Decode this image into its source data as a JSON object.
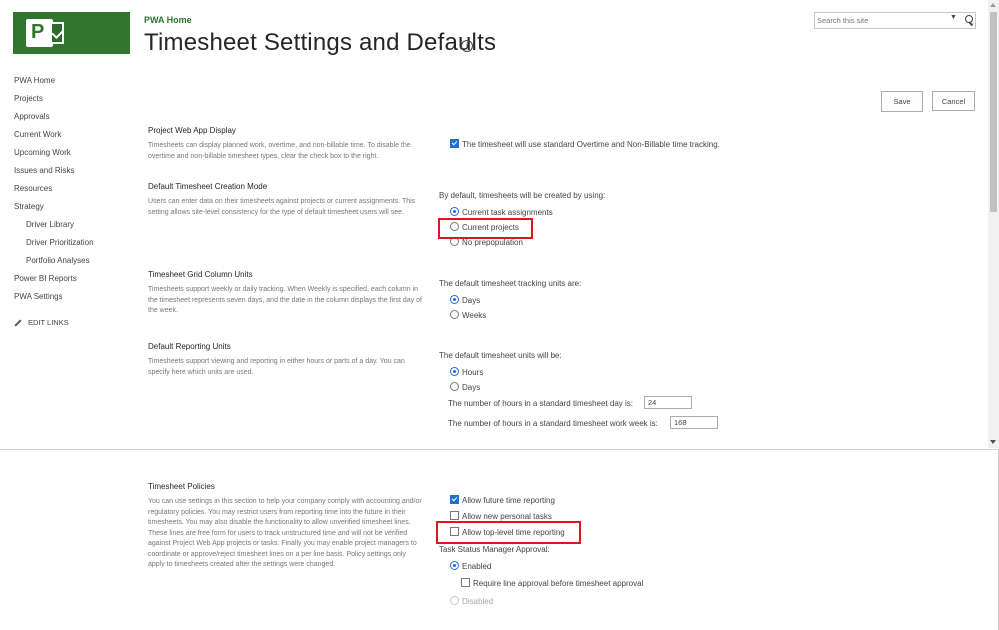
{
  "header": {
    "logo_letter": "P",
    "breadcrumb": "PWA Home",
    "title": "Timesheet Settings and Defaults",
    "info_glyph": "i"
  },
  "search": {
    "placeholder": "Search this site",
    "scope_glyph": "▼"
  },
  "nav": {
    "items": [
      {
        "label": "PWA Home"
      },
      {
        "label": "Projects"
      },
      {
        "label": "Approvals"
      },
      {
        "label": "Current Work"
      },
      {
        "label": "Upcoming Work"
      },
      {
        "label": "Issues and Risks"
      },
      {
        "label": "Resources"
      },
      {
        "label": "Strategy"
      },
      {
        "label": "Driver Library"
      },
      {
        "label": "Driver Prioritization"
      },
      {
        "label": "Portfolio Analyses"
      },
      {
        "label": "Power BI Reports"
      },
      {
        "label": "PWA Settings"
      }
    ],
    "edit_links": "EDIT LINKS"
  },
  "toolbar": {
    "save_label": "Save",
    "cancel_label": "Cancel"
  },
  "sections": {
    "display": {
      "title": "Project Web App Display",
      "desc": "Timesheets can display planned work, overtime, and non-billable time. To disable the overtime and non-billable timesheet types, clear the check box to the right.",
      "option": "The timesheet will use standard Overtime and Non-Billable time tracking.",
      "checked": true
    },
    "creation": {
      "title": "Default Timesheet Creation Mode",
      "desc": "Users can enter data on their timesheets against projects or current assignments. This setting allows site-level consistency for the type of default timesheet users will see.",
      "prompt": "By default, timesheets will be created by using:",
      "options": [
        "Current task assignments",
        "Current projects",
        "No prepopulation"
      ],
      "selected": 0
    },
    "grid": {
      "title": "Timesheet Grid Column Units",
      "desc": "Timesheets support weekly or daily tracking. When Weekly is specified, each column in the timesheet represents seven days, and the date in the column displays the first day of the week.",
      "prompt": "The default timesheet tracking units are:",
      "options": [
        "Days",
        "Weeks"
      ],
      "selected": 0
    },
    "reporting": {
      "title": "Default Reporting Units",
      "desc": "Timesheets support viewing and reporting in either hours or parts of a day. You can specify here which units are used.",
      "prompt": "The default timesheet units will be:",
      "options": [
        "Hours",
        "Days"
      ],
      "selected": 0,
      "hours_day_label": "The number of hours in a standard timesheet day is:",
      "hours_day_value": "24",
      "hours_week_label": "The number of hours in a standard timesheet work week is:",
      "hours_week_value": "168"
    },
    "policies": {
      "title": "Timesheet Policies",
      "desc": "You can use settings in this section to help your company comply with accounting and/or regulatory policies. You may restrict users from reporting time into the future in their timesheets. You may also disable the functionality to allow unverified timesheet lines. These lines are free form for users to track unstructured time and will not be verified against Project Web App projects or tasks. Finally you may enable project managers to coordinate or approve/reject timesheet lines on a per line basis. Policy settings only apply to timesheets created after the settings were changed.",
      "checks": [
        {
          "label": "Allow future time reporting",
          "checked": true
        },
        {
          "label": "Allow new personal tasks",
          "checked": false
        },
        {
          "label": "Allow top-level time reporting",
          "checked": false
        }
      ],
      "tsm_label": "Task Status Manager Approval:",
      "tsm_enabled": "Enabled",
      "tsm_line_approval": "Require line approval before timesheet approval",
      "tsm_disabled": "Disabled"
    }
  },
  "colors": {
    "brand": "#31752f",
    "accent": "#1e6fd0",
    "highlight": "#e0141e"
  }
}
